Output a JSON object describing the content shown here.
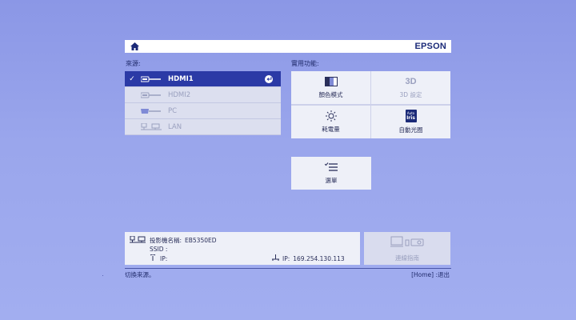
{
  "header": {
    "brand": "EPSON",
    "home_icon": "home-icon"
  },
  "source": {
    "label": "來源:",
    "items": [
      {
        "label": "HDMI1",
        "icon": "hdmi-icon",
        "selected": true
      },
      {
        "label": "HDMI2",
        "icon": "hdmi-icon",
        "selected": false
      },
      {
        "label": "PC",
        "icon": "vga-icon",
        "selected": false
      },
      {
        "label": "LAN",
        "icon": "lan-icon",
        "selected": false
      }
    ]
  },
  "functions": {
    "label": "實用功能:",
    "tiles": [
      {
        "label": "顏色模式",
        "icon": "color-mode-icon",
        "enabled": true
      },
      {
        "label": "3D 設定",
        "icon": "3d-icon",
        "enabled": false
      },
      {
        "label": "耗電量",
        "icon": "power-consumption-icon",
        "enabled": true
      },
      {
        "label": "自動光圈",
        "icon": "auto-iris-icon",
        "enabled": true
      }
    ],
    "menu_label": "選單"
  },
  "info": {
    "projector_name_label": "投影機名稱:",
    "projector_name": "EB5350ED",
    "ssid_label": "SSID :",
    "ip_label_wifi": "IP:",
    "ip_label_wired": "IP:",
    "ip_wired": "169.254.130.113"
  },
  "guide": {
    "label": "連線指南"
  },
  "footer": {
    "left": "切換來源。",
    "right": "[Home] :退出"
  },
  "colors": {
    "background": "#95a1ea",
    "selected": "#2b3aa6",
    "brand": "#1b2a78"
  },
  "icons": {
    "enter": "enter-icon",
    "auto_iris_top": "Auto",
    "auto_iris_bottom": "Iris",
    "three_d": "3D"
  }
}
